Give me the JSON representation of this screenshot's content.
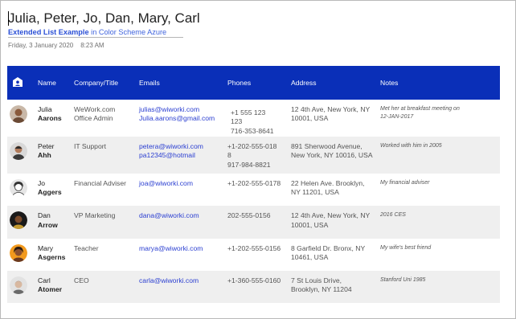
{
  "header": {
    "title": "Julia, Peter, Jo, Dan, Mary, Carl",
    "subtitle_strong": "Extended List Example",
    "subtitle_rest": " in Color Scheme Azure",
    "date": "Friday, 3 January 2020",
    "time": "8:23 AM"
  },
  "columns": {
    "icon": "contact-card-icon",
    "name": "Name",
    "company": "Company/Title",
    "emails": "Emails",
    "phones": "Phones",
    "address": "Address",
    "notes": "Notes"
  },
  "rows": [
    {
      "first": "Julia",
      "last": "Aarons",
      "company1": "WeWork.com",
      "company2": "Office Admin",
      "email1": "julias@wiworki.com",
      "email2": "Julia.aarons@gmail.com",
      "phone1": "+1 555 123",
      "phone2": "123",
      "phone3": "716-353-8641",
      "addr1": "12 4th Ave, New York, NY",
      "addr2": "10001, USA",
      "note1": "Met her at breakfast meeting on",
      "note2": "12-JAN-2017"
    },
    {
      "first": "Peter",
      "last": "Ahh",
      "company1": "IT Support",
      "company2": "",
      "email1": "petera@wiworki.com",
      "email2": "pa12345@hotmail",
      "phone1": "+1-202-555-018",
      "phone2": "8",
      "phone3": "917-984-8821",
      "addr1": "891 Sherwood Avenue,",
      "addr2": "New York, NY 10016, USA",
      "note1": "Worked with him in 2005",
      "note2": ""
    },
    {
      "first": "Jo",
      "last": "Aggers",
      "company1": "Financial Adviser",
      "company2": "",
      "email1": "joa@wiworki.com",
      "email2": "",
      "phone1": "+1-202-555-0178",
      "phone2": "",
      "phone3": "",
      "addr1": "22 Helen Ave. Brooklyn,",
      "addr2": "NY 11201, USA",
      "note1": "My financial adviser",
      "note2": ""
    },
    {
      "first": "Dan",
      "last": "Arrow",
      "company1": "VP Marketing",
      "company2": "",
      "email1": "dana@wiworki.com",
      "email2": "",
      "phone1": "202-555-0156",
      "phone2": "",
      "phone3": "",
      "addr1": "12 4th Ave, New York, NY",
      "addr2": "10001, USA",
      "note1": "2016 CES",
      "note2": ""
    },
    {
      "first": "Mary",
      "last": "Asgerns",
      "company1": "Teacher",
      "company2": "",
      "email1": "marya@wiworki.com",
      "email2": "",
      "phone1": "+1-202-555-0156",
      "phone2": "",
      "phone3": "",
      "addr1": "8 Garfield Dr. Bronx, NY",
      "addr2": "10461, USA",
      "note1": "My wife's best friend",
      "note2": ""
    },
    {
      "first": "Carl",
      "last": "Atomer",
      "company1": "CEO",
      "company2": "",
      "email1": "carla@wiworki.com",
      "email2": "",
      "phone1": "+1-360-555-0160",
      "phone2": "",
      "phone3": "",
      "addr1": "7 St Louis Drive,",
      "addr2": "Brooklyn, NY 11204",
      "note1": "Stanford Uni 1985",
      "note2": ""
    }
  ],
  "colors": {
    "header_bg": "#0a2fb8",
    "link": "#2b3fd1",
    "alt_row": "#efefef"
  }
}
